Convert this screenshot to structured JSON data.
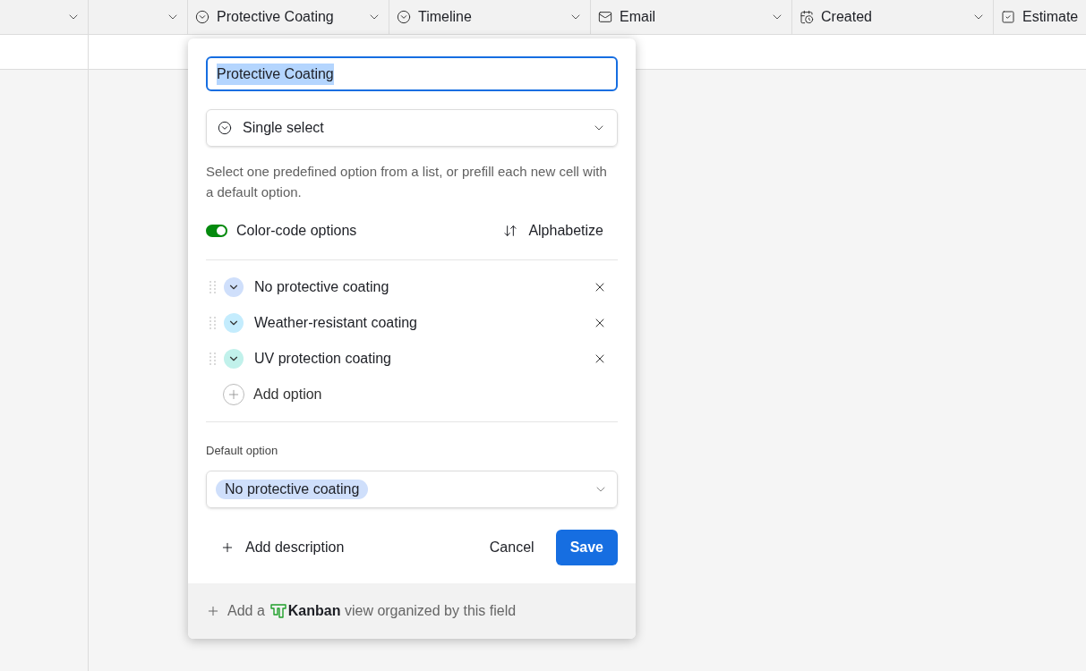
{
  "columns": [
    {
      "kind": "blank"
    },
    {
      "kind": "blank"
    },
    {
      "label": "Protective Coating",
      "kind": "select"
    },
    {
      "label": "Timeline",
      "kind": "select"
    },
    {
      "label": "Email",
      "kind": "email"
    },
    {
      "label": "Created",
      "kind": "created"
    },
    {
      "label": "Estimate",
      "kind": "checkbox"
    }
  ],
  "dialog": {
    "name": {
      "value": "Protective Coating",
      "text_selected": true
    },
    "type": {
      "label": "Single select"
    },
    "description": "Select one predefined option from a list, or prefill each new cell with a default option.",
    "color_code": {
      "label": "Color-code options",
      "on": true
    },
    "alphabetize": "Alphabetize",
    "options": [
      {
        "label": "No protective coating",
        "color": "#cfdffb"
      },
      {
        "label": "Weather-resistant coating",
        "color": "#c4ecfd"
      },
      {
        "label": "UV protection coating",
        "color": "#c1f1eb"
      }
    ],
    "add_option": "Add option",
    "default_label": "Default option",
    "default_value": {
      "label": "No protective coating",
      "color": "#cfdffb"
    },
    "add_description": "Add description",
    "cancel": "Cancel",
    "save": "Save",
    "footer": {
      "prefix": "Add a",
      "text": "**Kanban** view organized by this field"
    }
  }
}
